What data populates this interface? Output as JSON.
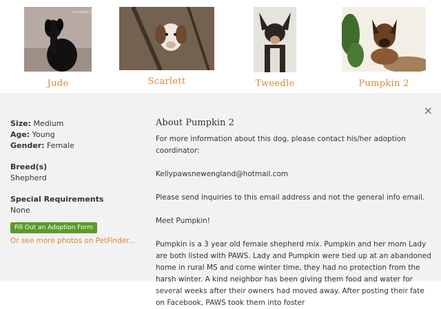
{
  "dogs": [
    {
      "name": "Jude"
    },
    {
      "name": "Scarlett"
    },
    {
      "name": "Tweedle"
    },
    {
      "name": "Pumpkin 2"
    }
  ],
  "detail": {
    "close_glyph": "×",
    "size_label": "Size:",
    "size_value": "Medium",
    "age_label": "Age:",
    "age_value": "Young",
    "gender_label": "Gender:",
    "gender_value": "Female",
    "breed_label": "Breed(s)",
    "breed_value": "Shepherd",
    "special_label": "Special Requirements",
    "special_value": "None",
    "adopt_button": "Fill Out an Adoption Form",
    "petfinder_link": "Or see more photos on PetFinder...",
    "about_title": "About Pumpkin 2",
    "para1": "For more information about this dog, please contact his/her adoption coordinator:",
    "email": "Kellypawsnewengland@hotmail.com",
    "para2": "Please send inquiries to this email address and not the general info email.",
    "para3": "Meet Pumpkin!",
    "para4": "Pumpkin is a 3 year old female shepherd mix. Pumpkin and her mom Lady are both listed with PAWS. Lady and Pumpkin were tied up at an abandoned home in rural MS and come winter time, they had no protection from the harsh winter. A kind neighbor has been giving them food and water for several weeks after their owners had moved away. After posting their fate on Facebook, PAWS took them into foster"
  },
  "colors": {
    "accent": "#d9873b",
    "button": "#5b9a2c",
    "panel": "#f2f2f2"
  }
}
